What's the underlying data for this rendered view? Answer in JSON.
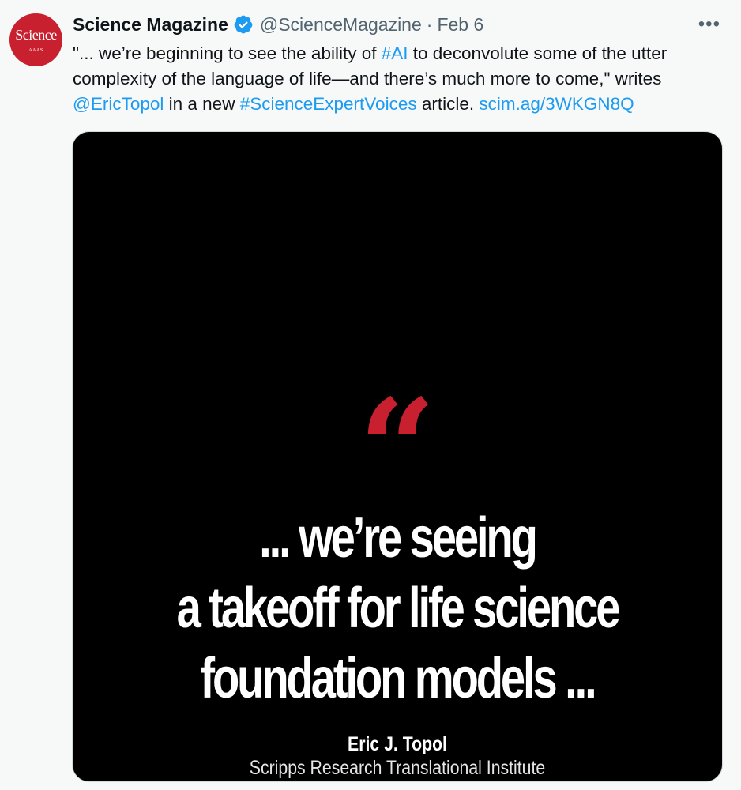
{
  "account": {
    "avatar_text": "Science",
    "avatar_subtext": "AAAS",
    "name": "Science Magazine",
    "handle": "@ScienceMagazine",
    "separator": "·",
    "date": "Feb 6",
    "verified_icon": "verified-badge-icon",
    "brand_color": "#c8202e"
  },
  "menu": {
    "more_label": "•••"
  },
  "tweet": {
    "seg1": "\"... we’re beginning to see the ability of ",
    "hashtag_ai": "#AI",
    "seg2": " to deconvolute some of the utter complexity of the language of life—and there’s much more to come,\" writes ",
    "mention": "@EricTopol",
    "seg3": " in a new ",
    "hashtag_voices": "#ScienceExpertVoices",
    "seg4": " article. ",
    "link": "scim.ag/3WKGN8Q",
    "link_color": "#1d9bf0"
  },
  "media": {
    "quote_mark": "“",
    "quote_lines": [
      "... we’re seeing",
      "a takeoff for life science",
      "foundation models ..."
    ],
    "author": "Eric J. Topol",
    "affiliation": "Scripps Research Translational Institute",
    "background": "#000000"
  }
}
